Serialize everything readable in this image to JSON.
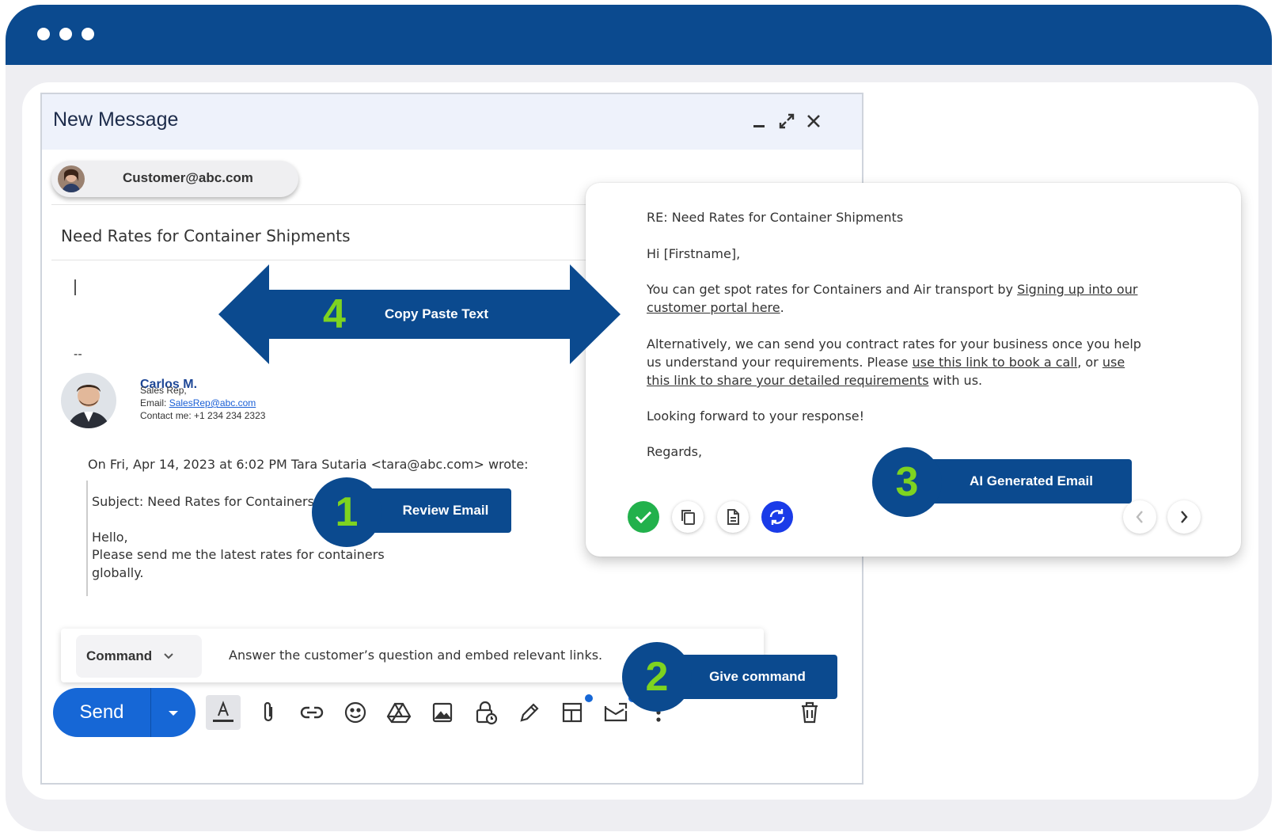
{
  "compose": {
    "title": "New Message",
    "recipient": "Customer@abc.com",
    "subject": "Need Rates for Container Shipments",
    "signature": {
      "dashes": "--",
      "name": "Carlos M.",
      "role": "Sales Rep,",
      "email_label": "Email: ",
      "email": "SalesRep@abc.com",
      "contact": "Contact me: +1 234 234 2323"
    },
    "quote": {
      "header": "On Fri, Apr 14, 2023 at 6:02 PM Tara Sutaria <tara@abc.com> wrote:",
      "subject_line": "Subject: Need Rates for Containers",
      "greeting": "Hello,",
      "body_line1": "Please send me the latest rates for containers",
      "body_line2": "globally."
    },
    "command": {
      "select_label": "Command",
      "text": "Answer the customer’s question and embed relevant links."
    },
    "send_label": "Send"
  },
  "ai_email": {
    "subject": "RE: Need Rates for Container Shipments",
    "greeting": "Hi [Firstname],",
    "p1_text": "You can get spot rates for Containers and Air transport by ",
    "p1_link": "Signing up into our",
    "p1_link_cont": "customer portal here",
    "p1_end": ".",
    "p2_line1": "Alternatively, we can send you contract rates for your business once you help",
    "p2_line2_text": "us understand your requirements. Please ",
    "p2_link1": "use this link to book a call",
    "p2_line2_mid": ", or ",
    "p2_link2a": "use",
    "p2_link2b": "this link to share your detailed requirements",
    "p2_end": " with us.",
    "closing": "Looking forward to your response!",
    "sign_off": "Regards,"
  },
  "callouts": {
    "review": {
      "number": "1",
      "label": "Review Email"
    },
    "command": {
      "number": "2",
      "label": "Give command"
    },
    "ai": {
      "number": "3",
      "label": "AI Generated Email"
    },
    "copy": {
      "number": "4",
      "label": "Copy Paste Text"
    }
  },
  "colors": {
    "brand_navy": "#0b4a8f",
    "accent_green": "#7ed320",
    "send_blue": "#1667d6",
    "check_green": "#22b14c",
    "regen_blue": "#1a3be8"
  },
  "icons": {
    "window": [
      "minimize-icon",
      "expand-icon",
      "close-icon"
    ],
    "toolbar": [
      "format-text-icon",
      "attach-icon",
      "link-icon",
      "emoji-icon",
      "drive-icon",
      "image-icon",
      "confidential-lock-icon",
      "signature-pen-icon",
      "layout-template-icon",
      "email-template-icon",
      "more-options-icon",
      "trash-icon"
    ],
    "ai_actions": [
      "accept-check-icon",
      "copy-icon",
      "document-icon",
      "regenerate-icon",
      "prev-arrow-icon",
      "next-arrow-icon"
    ]
  }
}
